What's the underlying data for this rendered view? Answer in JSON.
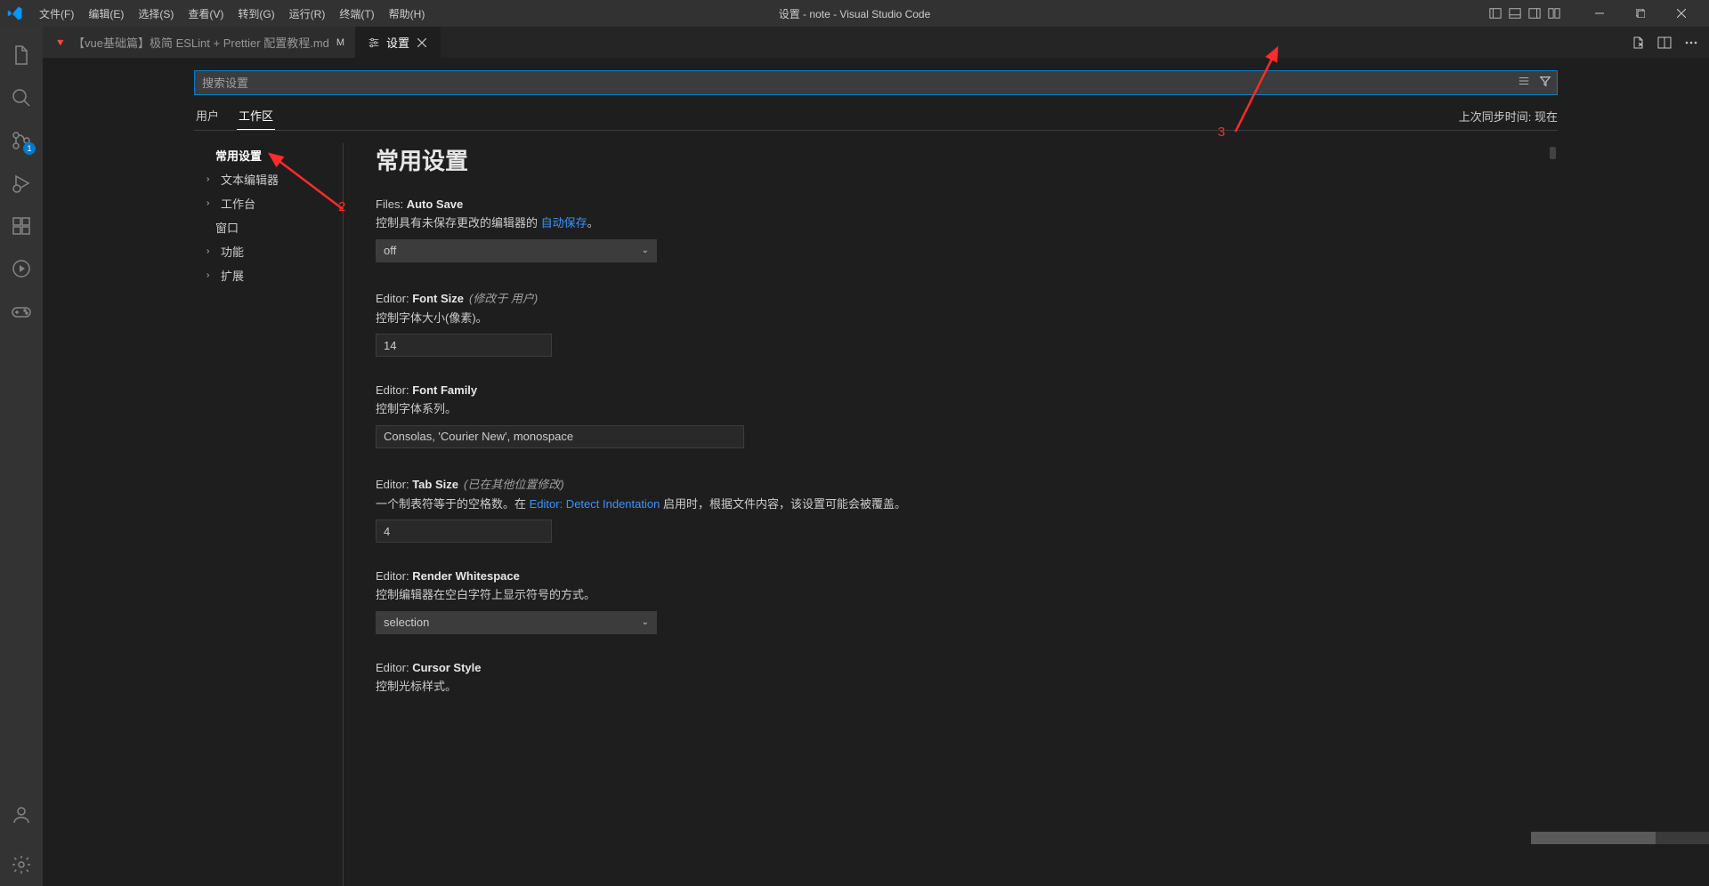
{
  "titlebar": {
    "menus": [
      "文件(F)",
      "编辑(E)",
      "选择(S)",
      "查看(V)",
      "转到(G)",
      "运行(R)",
      "终端(T)",
      "帮助(H)"
    ],
    "title": "设置 - note - Visual Studio Code"
  },
  "activitybar": {
    "source_control_badge": "1"
  },
  "tabs": [
    {
      "label": "【vue基础篇】极简 ESLint + Prettier 配置教程.md",
      "modified": "M",
      "active": false
    },
    {
      "label": "设置",
      "active": true
    }
  ],
  "search": {
    "placeholder": "搜索设置"
  },
  "scope": {
    "user": "用户",
    "workspace": "工作区",
    "sync": "上次同步时间: 现在"
  },
  "toc": {
    "common": "常用设置",
    "text_editor": "文本编辑器",
    "workbench": "工作台",
    "window": "窗口",
    "features": "功能",
    "extensions": "扩展"
  },
  "content": {
    "heading": "常用设置",
    "autosave": {
      "scope": "Files:",
      "name": "Auto Save",
      "desc_pre": "控制具有未保存更改的编辑器的 ",
      "link": "自动保存",
      "desc_post": "。",
      "value": "off"
    },
    "fontsize": {
      "scope": "Editor:",
      "name": "Font Size",
      "hint": "(修改于 用户)",
      "desc": "控制字体大小(像素)。",
      "value": "14"
    },
    "fontfamily": {
      "scope": "Editor:",
      "name": "Font Family",
      "desc": "控制字体系列。",
      "value": "Consolas, 'Courier New', monospace"
    },
    "tabsize": {
      "scope": "Editor:",
      "name": "Tab Size",
      "hint": "(已在其他位置修改)",
      "desc_pre": "一个制表符等于的空格数。在 ",
      "link": "Editor: Detect Indentation",
      "desc_post": " 启用时，根据文件内容，该设置可能会被覆盖。",
      "value": "4"
    },
    "whitespace": {
      "scope": "Editor:",
      "name": "Render Whitespace",
      "desc": "控制编辑器在空白字符上显示符号的方式。",
      "value": "selection"
    },
    "cursorstyle": {
      "scope": "Editor:",
      "name": "Cursor Style",
      "desc": "控制光标样式。"
    }
  },
  "annotations": {
    "n2": "2",
    "n3": "3"
  }
}
